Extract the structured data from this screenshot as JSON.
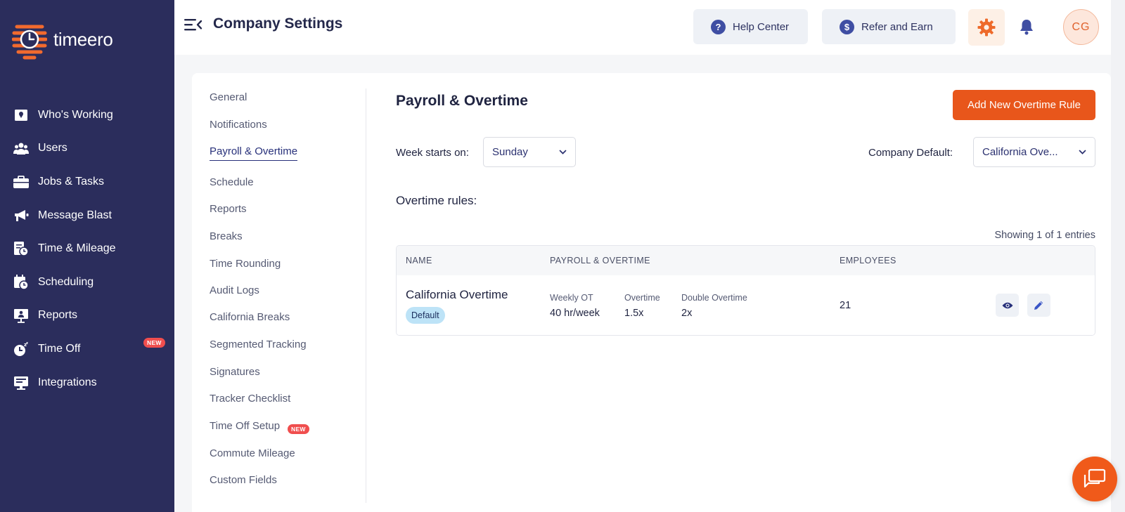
{
  "brand": {
    "name": "timeero",
    "accent": "#e8561b",
    "sidebar_bg": "#2b2d5c"
  },
  "sidebar": {
    "items": [
      {
        "label": "Who's Working",
        "icon": "map-pin-icon"
      },
      {
        "label": "Users",
        "icon": "users-icon"
      },
      {
        "label": "Jobs & Tasks",
        "icon": "briefcase-icon"
      },
      {
        "label": "Message Blast",
        "icon": "megaphone-icon"
      },
      {
        "label": "Time & Mileage",
        "icon": "clock-document-icon"
      },
      {
        "label": "Scheduling",
        "icon": "calendar-clock-icon"
      },
      {
        "label": "Reports",
        "icon": "presentation-icon"
      },
      {
        "label": "Time Off",
        "icon": "time-off-icon",
        "badge": "NEW"
      },
      {
        "label": "Integrations",
        "icon": "monitor-icon"
      }
    ]
  },
  "header": {
    "title": "Company Settings",
    "help_center": "Help Center",
    "refer_earn": "Refer and Earn",
    "avatar_initials": "CG"
  },
  "subnav": {
    "items": [
      {
        "label": "General"
      },
      {
        "label": "Notifications"
      },
      {
        "label": "Payroll & Overtime",
        "active": true
      },
      {
        "label": "Schedule"
      },
      {
        "label": "Reports"
      },
      {
        "label": "Breaks"
      },
      {
        "label": "Time Rounding"
      },
      {
        "label": "Audit Logs"
      },
      {
        "label": "California Breaks"
      },
      {
        "label": "Segmented Tracking"
      },
      {
        "label": "Signatures"
      },
      {
        "label": "Tracker Checklist"
      },
      {
        "label": "Time Off Setup",
        "badge": "NEW"
      },
      {
        "label": "Commute Mileage"
      },
      {
        "label": "Custom Fields"
      }
    ]
  },
  "main": {
    "title": "Payroll & Overtime",
    "add_button": "Add New Overtime Rule",
    "week_starts_label": "Week starts on:",
    "week_starts_value": "Sunday",
    "company_default_label": "Company Default:",
    "company_default_value": "California Ove...",
    "overtime_rules_label": "Overtime rules:",
    "entries_text": "Showing 1 of 1 entries",
    "table": {
      "headers": [
        "NAME",
        "PAYROLL & OVERTIME",
        "EMPLOYEES"
      ],
      "rows": [
        {
          "name": "California Overtime",
          "badge": "Default",
          "weekly_ot_label": "Weekly OT",
          "weekly_ot_value": "40 hr/week",
          "overtime_label": "Overtime",
          "overtime_value": "1.5x",
          "double_overtime_label": "Double Overtime",
          "double_overtime_value": "2x",
          "employees": "21"
        }
      ]
    }
  }
}
